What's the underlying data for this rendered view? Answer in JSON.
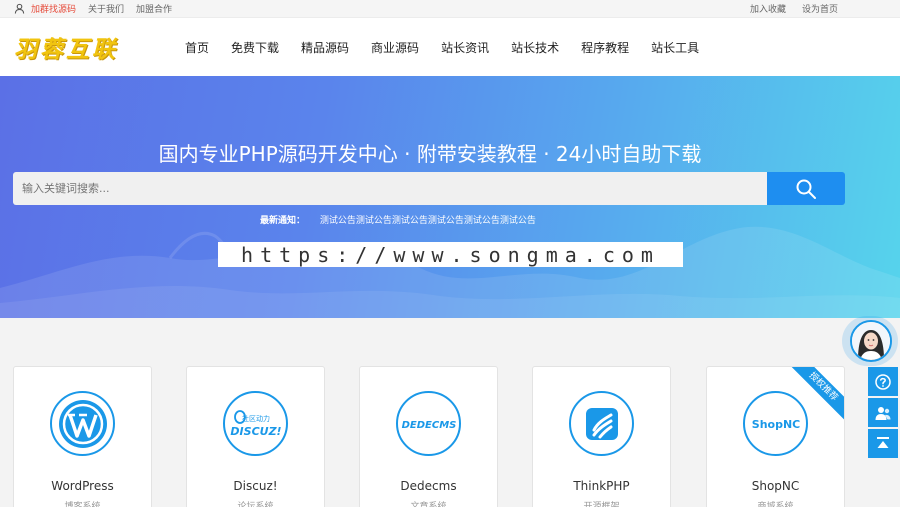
{
  "topbar": {
    "left_links": [
      "加群找源码",
      "关于我们",
      "加盟合作"
    ],
    "right_links": [
      "加入收藏",
      "设为首页"
    ]
  },
  "header": {
    "logo_text": "羽蓉互联",
    "nav": [
      "首页",
      "免费下载",
      "精品源码",
      "商业源码",
      "站长资讯",
      "站长技术",
      "程序教程",
      "站长工具"
    ]
  },
  "hero": {
    "title": "国内专业PHP源码开发中心 · 附带安装教程 · 24小时自助下载",
    "search_placeholder": "输入关键词搜索...",
    "notice_label": "最新通知：",
    "notice_text": "测试公告测试公告测试公告测试公告测试公告测试公告",
    "url_text": "https://www.songma.com"
  },
  "cards": [
    {
      "name": "WordPress",
      "sub": "博客系统",
      "icon": "wordpress-icon"
    },
    {
      "name": "Discuz!",
      "sub": "论坛系统",
      "icon": "discuz-icon",
      "icon_text": "DISCUZ!",
      "icon_sub": "社区动力"
    },
    {
      "name": "Dedecms",
      "sub": "文章系统",
      "icon": "dedecms-icon",
      "icon_text": "DEDECMS"
    },
    {
      "name": "ThinkPHP",
      "sub": "开源框架",
      "icon": "thinkphp-icon"
    },
    {
      "name": "ShopNC",
      "sub": "商城系统",
      "icon": "shopnc-icon",
      "icon_text": "ShopNC",
      "ribbon": "授权推荐"
    }
  ],
  "colors": {
    "accent": "#1a98e8",
    "hot": "#e64b3b",
    "hero_start": "#5b70e6",
    "hero_end": "#56d4ec"
  }
}
